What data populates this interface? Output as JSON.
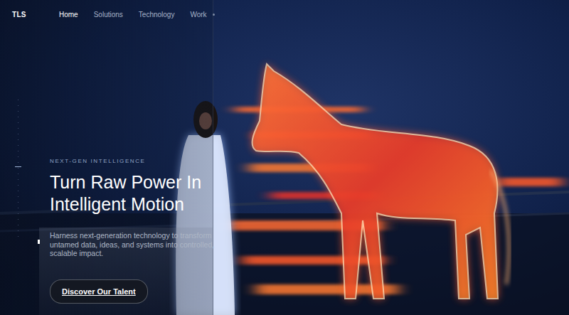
{
  "brand": "TLS",
  "nav": [
    {
      "label": "Home",
      "selected": true
    },
    {
      "label": "Solutions",
      "selected": false
    },
    {
      "label": "Technology",
      "selected": false
    },
    {
      "label": "Work",
      "selected": false
    }
  ],
  "hero": {
    "eyebrow": "NEXT-GEN INTELLIGENCE",
    "title_lines": [
      "Turn Raw Power In",
      "Intelligent Motion"
    ],
    "description": "Harness next-generation technology to transform untamed data, ideas, and systems into controlled, scalable impact.",
    "button": "Discover Our Talent"
  }
}
